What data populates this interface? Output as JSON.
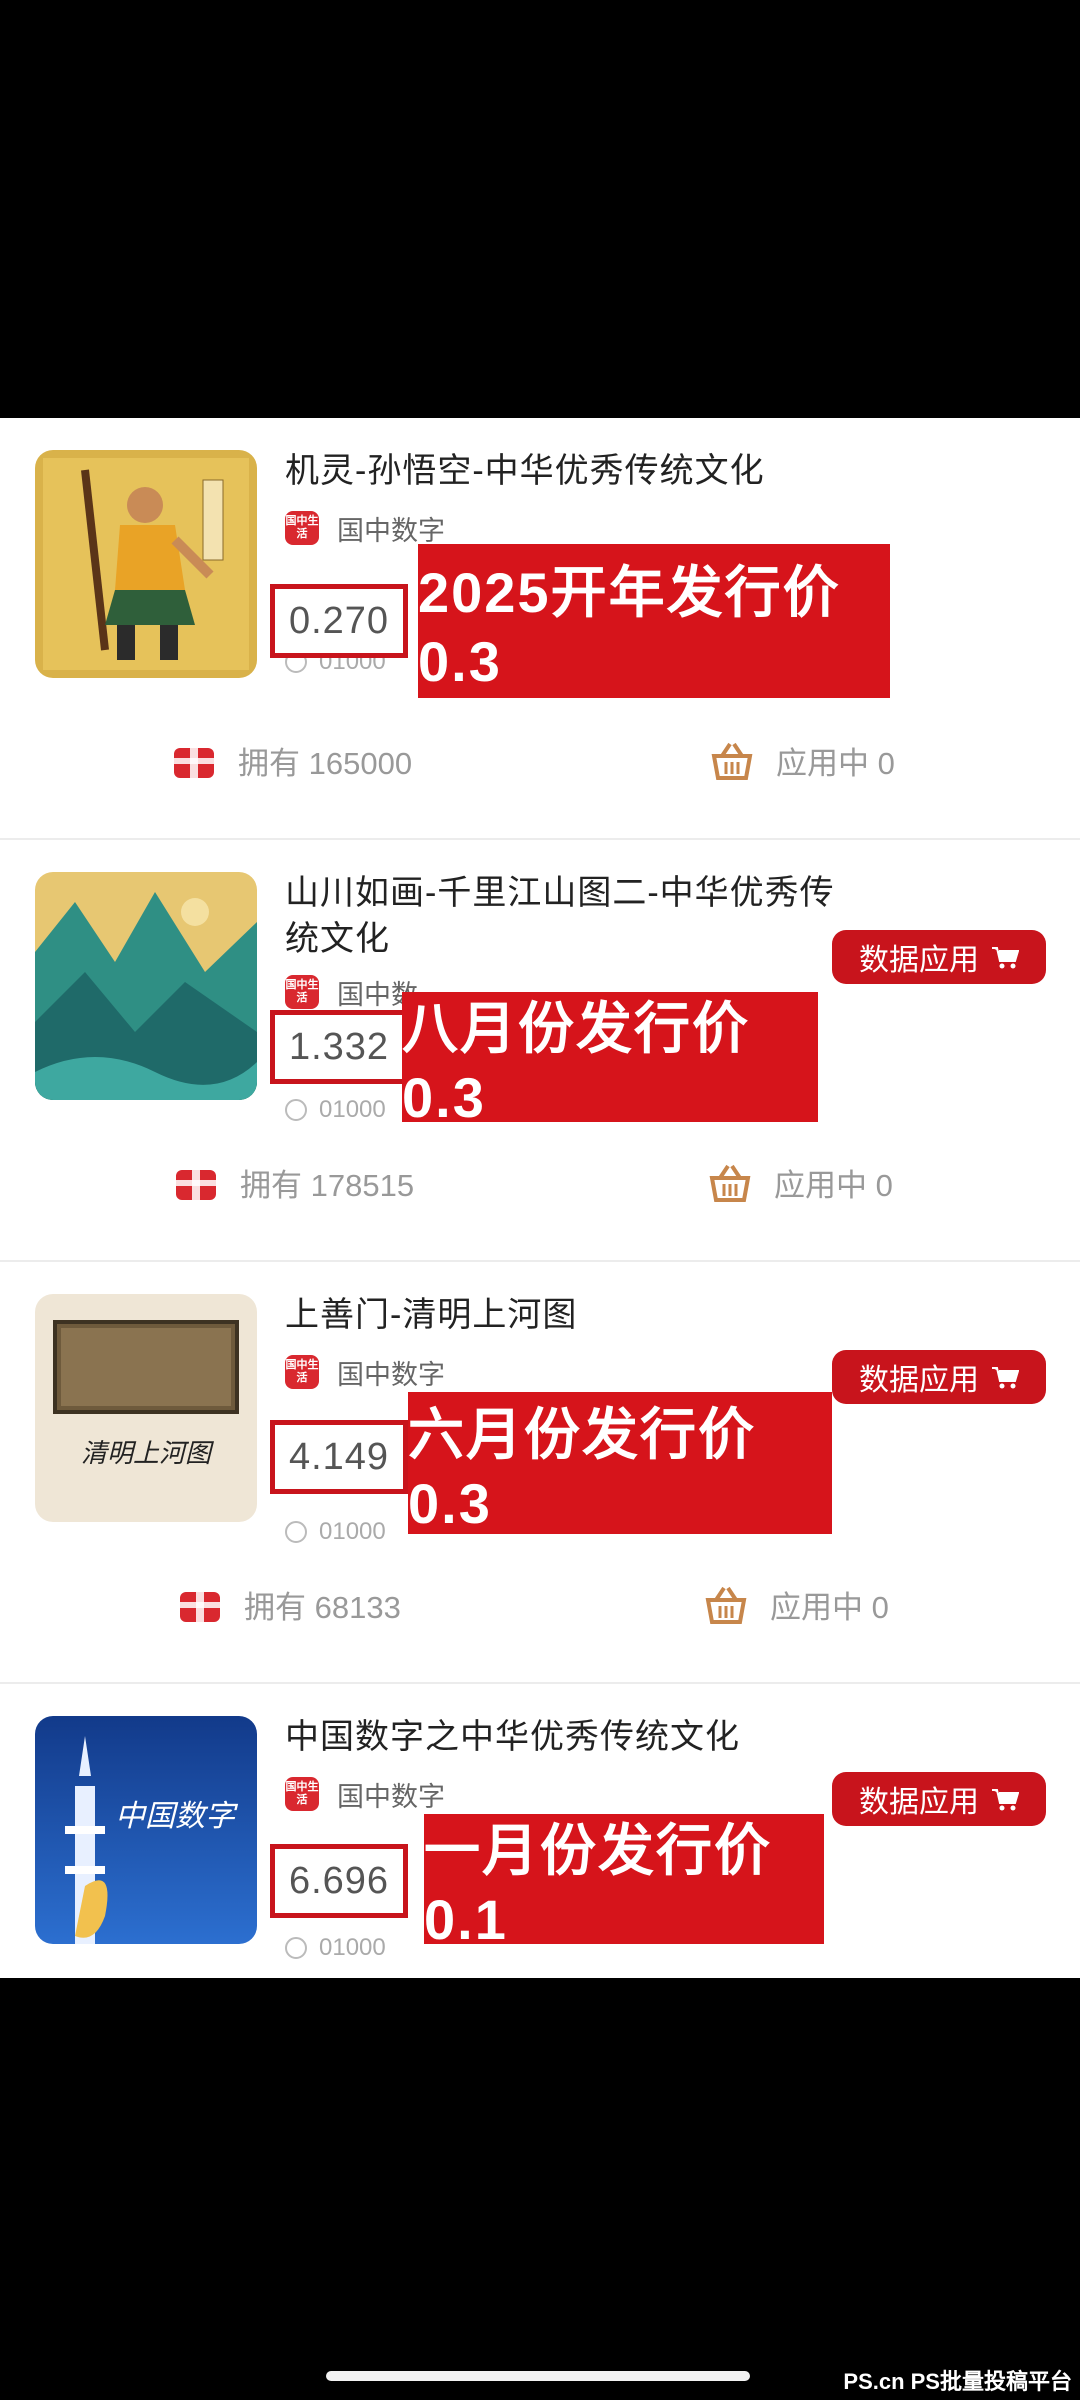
{
  "items": [
    {
      "title": "机灵-孙悟空-中华优秀传统文化",
      "publisher": "国中数字",
      "publisher_logo": "国中生活",
      "price": "0.270",
      "serial": "01000",
      "banner": "2025开年发行价0.3",
      "owned_label": "拥有 165000",
      "in_use_label": "应用中 0",
      "data_button": ""
    },
    {
      "title": "山川如画-千里江山图二-中华优秀传统文化",
      "publisher": "国中数",
      "publisher_logo": "国中生活",
      "price": "1.332",
      "serial": "01000",
      "banner": "八月份发行价0.3",
      "owned_label": "拥有 178515",
      "in_use_label": "应用中 0",
      "data_button": "数据应用"
    },
    {
      "title": "上善门-清明上河图",
      "publisher": "国中数字",
      "publisher_logo": "国中生活",
      "price": "4.149",
      "serial": "01000",
      "banner": "六月份发行价0.3",
      "owned_label": "拥有 68133",
      "in_use_label": "应用中 0",
      "data_button": "数据应用"
    },
    {
      "title": "中国数字之中华优秀传统文化",
      "publisher": "国中数字",
      "publisher_logo": "国中生活",
      "price": "6.696",
      "serial": "01000",
      "banner": "一月份发行价0.1",
      "owned_label": "",
      "in_use_label": "",
      "data_button": "数据应用"
    }
  ],
  "thumb_texts": {
    "item3_calligraphy": "清明上河图",
    "item4_calligraphy": "中国数字"
  },
  "watermark": "PS.cn PS批量投稿平台",
  "colors": {
    "accent": "#d6141b",
    "price_border": "#c8141c",
    "text": "#222222",
    "muted": "#999999"
  },
  "icons": {
    "owned": "gift-box-icon",
    "in_use": "basket-icon",
    "cart": "cart-icon",
    "serial": "clock-icon"
  }
}
